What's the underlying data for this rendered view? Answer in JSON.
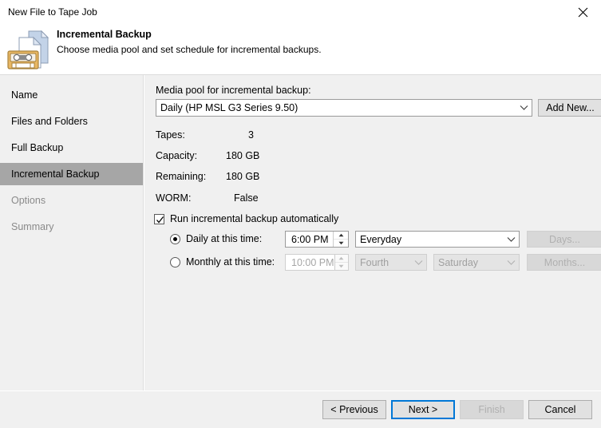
{
  "window": {
    "title": "New File to Tape Job",
    "close_icon": "close-icon"
  },
  "header": {
    "icon": "tape-job-icon",
    "title": "Incremental Backup",
    "subtitle": "Choose media pool and set schedule for incremental backups."
  },
  "sidebar": {
    "items": [
      {
        "label": "Name",
        "state": "normal"
      },
      {
        "label": "Files and Folders",
        "state": "normal"
      },
      {
        "label": "Full Backup",
        "state": "normal"
      },
      {
        "label": "Incremental Backup",
        "state": "selected"
      },
      {
        "label": "Options",
        "state": "disabled"
      },
      {
        "label": "Summary",
        "state": "disabled"
      }
    ]
  },
  "main": {
    "media_pool_label": "Media pool for incremental backup:",
    "media_pool_value": "Daily (HP MSL G3 Series 9.50)",
    "add_new_label": "Add New...",
    "info": [
      {
        "label": "Tapes:",
        "value": "3"
      },
      {
        "label": "Capacity:",
        "value": "180 GB"
      },
      {
        "label": "Remaining:",
        "value": "180 GB"
      },
      {
        "label": "WORM:",
        "value": "False"
      }
    ],
    "run_auto_label": "Run incremental backup automatically",
    "run_auto_checked": true,
    "daily": {
      "label": "Daily at this time:",
      "selected": true,
      "time": "6:00 PM",
      "frequency": "Everyday",
      "days_button": "Days..."
    },
    "monthly": {
      "label": "Monthly at this time:",
      "selected": false,
      "time": "10:00 PM",
      "week": "Fourth",
      "weekday": "Saturday",
      "months_button": "Months..."
    }
  },
  "footer": {
    "previous": "< Previous",
    "next": "Next >",
    "finish": "Finish",
    "cancel": "Cancel"
  },
  "colors": {
    "accent": "#0078d7",
    "panel": "#f0f0f0",
    "selection": "#a6a6a6",
    "disabled_text": "#9a9a9a"
  }
}
